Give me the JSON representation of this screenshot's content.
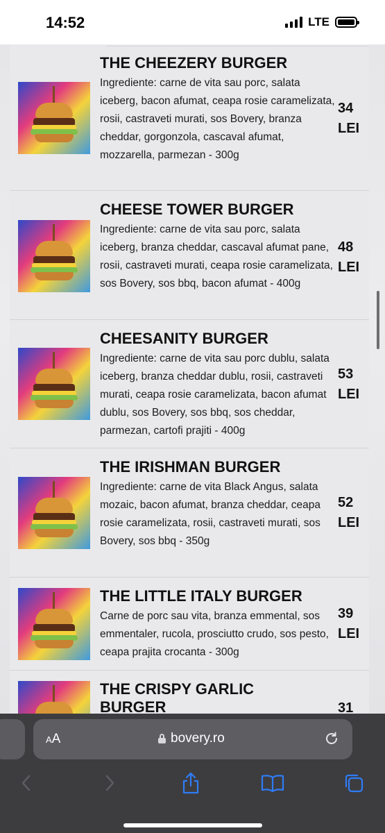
{
  "status_bar": {
    "time": "14:52",
    "network": "LTE"
  },
  "menu": {
    "items": [
      {
        "name": "THE CHEEZERY BURGER",
        "description": "Ingrediente: carne de vita sau porc, salata iceberg, bacon afumat, ceapa rosie caramelizata, rosii, castraveti murati, sos Bovery, branza cheddar, gorgonzola, cascaval afumat, mozzarella, parmezan - 300g",
        "price": "34",
        "currency": "LEI"
      },
      {
        "name": "CHEESE TOWER BURGER",
        "description": "Ingrediente: carne de vita sau porc, salata iceberg, branza cheddar, cascaval afumat pane, rosii, castraveti murati, ceapa rosie caramelizata, sos Bovery, sos bbq, bacon afumat - 400g",
        "price": "48",
        "currency": "LEI"
      },
      {
        "name": "CHEESANITY BURGER",
        "description": "Ingrediente: carne de vita sau porc dublu, salata iceberg, branza cheddar dublu, rosii, castraveti murati, ceapa rosie caramelizata, bacon afumat dublu, sos Bovery, sos bbq, sos cheddar, parmezan, cartofi prajiti - 400g",
        "price": "53",
        "currency": "LEI"
      },
      {
        "name": "THE IRISHMAN BURGER",
        "description": "Ingrediente: carne de vita Black Angus, salata mozaic, bacon afumat, branza cheddar, ceapa rosie caramelizata, rosii, castraveti murati, sos Bovery, sos bbq - 350g",
        "price": "52",
        "currency": "LEI"
      },
      {
        "name": "THE LITTLE ITALY BURGER",
        "description": "Carne de porc sau vita, branza emmental, sos emmentaler, rucola, prosciutto crudo, sos pesto, ceapa prajita crocanta - 300g",
        "price": "39",
        "currency": "LEI"
      },
      {
        "name": "THE CRISPY GARLIC BURGER",
        "description": "",
        "price": "31",
        "currency": ""
      }
    ]
  },
  "browser": {
    "text_size_label": "AA",
    "url": "bovery.ro"
  },
  "icons": {
    "lock": "lock-icon",
    "reload": "reload-icon",
    "back": "chevron-left-icon",
    "forward": "chevron-right-icon",
    "share": "share-icon",
    "bookmarks": "book-icon",
    "tabs": "tabs-icon"
  },
  "colors": {
    "browser_bar": "#3d3d40",
    "accent": "#2f7cf6"
  }
}
